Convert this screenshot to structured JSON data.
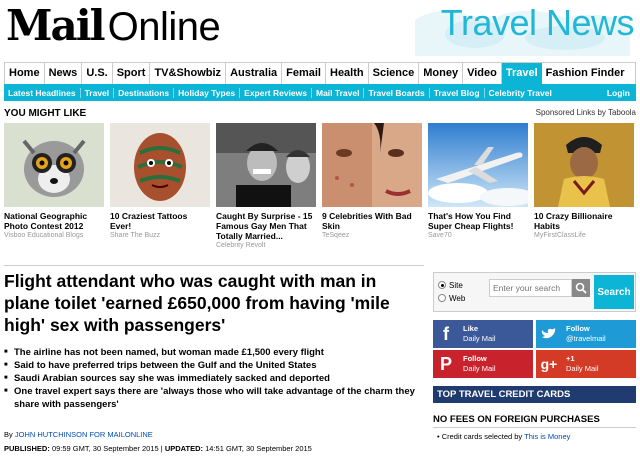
{
  "masthead": {
    "logo_bold": "Mail",
    "logo_light": "Online",
    "section_title": "Travel News"
  },
  "primary_nav": {
    "items": [
      "Home",
      "News",
      "U.S.",
      "Sport",
      "TV&Showbiz",
      "Australia",
      "Femail",
      "Health",
      "Science",
      "Money",
      "Video",
      "Travel",
      "Fashion Finder"
    ],
    "active": "Travel"
  },
  "sub_nav": {
    "items": [
      "Latest Headlines",
      "Travel",
      "Destinations",
      "Holiday Types",
      "Expert Reviews",
      "Mail Travel",
      "Travel Boards",
      "Travel Blog",
      "Celebrity Travel"
    ],
    "login": "Login"
  },
  "you_might_like": {
    "title": "YOU MIGHT LIKE",
    "sponsor": "Sponsored Links by Taboola",
    "cards": [
      {
        "caption": "National Geographic Photo Contest 2012",
        "source": "Visboo Educational Blogs",
        "icon": "lemur-photo"
      },
      {
        "caption": "10 Craziest Tattoos Ever!",
        "source": "Share The Buzz",
        "icon": "tattoo-face-photo"
      },
      {
        "caption": "Caught By Surprise - 15 Famous Gay Men That Totally Married...",
        "source": "Celebrity Revolt",
        "icon": "celebrity-photo"
      },
      {
        "caption": "9 Celebrities With Bad Skin",
        "source": "TeSqeez",
        "icon": "skin-closeup-photo"
      },
      {
        "caption": "That's How You Find Super Cheap Flights!",
        "source": "Save70",
        "icon": "airplane-photo"
      },
      {
        "caption": "10 Crazy Billionaire Habits",
        "source": "MyFirstClassLife",
        "icon": "billionaire-photo"
      }
    ]
  },
  "article": {
    "headline": "Flight attendant who was caught with man in plane toilet 'earned £650,000 from having 'mile high' sex with passengers'",
    "bullets": [
      "The airline has not been named, but woman made £1,500 every flight",
      "Said to have preferred trips between the Gulf and the United States",
      "Saudi Arabian sources say she was immediately sacked and deported",
      "One travel expert says there are 'always those who will take advantage of the charm they share with passengers'"
    ],
    "byline_prefix": "By",
    "author": "JOHN HUTCHINSON FOR MAILONLINE",
    "published_label": "PUBLISHED:",
    "published": "09:59 GMT, 30 September 2015",
    "updated_label": "UPDATED:",
    "updated": "14:51 GMT, 30 September 2015"
  },
  "search": {
    "scope_site": "Site",
    "scope_web": "Web",
    "placeholder": "Enter your search",
    "button": "Search"
  },
  "social": {
    "facebook": {
      "line1": "Like",
      "line2": "Daily Mail"
    },
    "twitter": {
      "line1": "Follow",
      "line2": "@travelmail"
    },
    "pinterest": {
      "line1": "Follow",
      "line2": "Daily Mail"
    },
    "google": {
      "line1": "+1",
      "line2": "Daily Mail"
    }
  },
  "credit_cards": {
    "header": "TOP TRAVEL CREDIT CARDS",
    "subheader": "NO FEES ON FOREIGN PURCHASES",
    "note_prefix": "• Credit cards selected by",
    "note_link": "This is Money"
  }
}
